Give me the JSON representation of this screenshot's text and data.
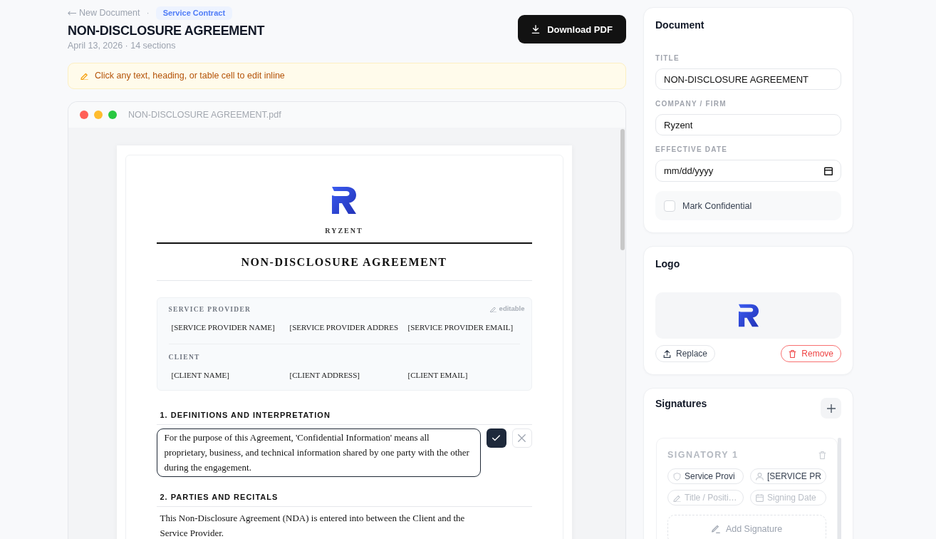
{
  "header": {
    "back_link": "New Document",
    "separator": "·",
    "badge": "Service Contract",
    "title": "NON-DISCLOSURE AGREEMENT",
    "meta": "April 13, 2026 · 14 sections",
    "download_button": "Download PDF"
  },
  "notice": {
    "text": "Click any text, heading, or table cell to edit inline"
  },
  "preview": {
    "filename": "NON-DISCLOSURE AGREEMENT.pdf",
    "document": {
      "company": "RYZENT",
      "title": "NON-DISCLOSURE AGREEMENT",
      "parties_hint": "editable",
      "parties": [
        {
          "label": "SERVICE PROVIDER",
          "values": [
            "[SERVICE PROVIDER NAME]",
            "[SERVICE PROVIDER ADDRES",
            "[SERVICE PROVIDER EMAIL]"
          ]
        },
        {
          "label": "CLIENT",
          "values": [
            "[CLIENT NAME]",
            "[CLIENT ADDRESS]",
            "[CLIENT EMAIL]"
          ]
        }
      ],
      "sections": [
        {
          "heading": "1. DEFINITIONS AND INTERPRETATION",
          "body": "For the purpose of this Agreement, 'Confidential Information' means all proprietary, business, and technical information shared by one party with the other during the engagement.",
          "editing": true
        },
        {
          "heading": "2. PARTIES AND RECITALS",
          "body": "This Non-Disclosure Agreement (NDA) is entered into between the Client and the Service Provider.",
          "editing": false
        }
      ]
    }
  },
  "sidebar": {
    "document": {
      "title": "Document",
      "fields": [
        {
          "kind": "text",
          "label": "TITLE",
          "value": "NON-DISCLOSURE AGREEMENT"
        },
        {
          "kind": "text",
          "label": "COMPANY / FIRM",
          "value": "Ryzent"
        },
        {
          "kind": "date",
          "label": "EFFECTIVE DATE",
          "placeholder": "mm/dd/yyyy"
        }
      ],
      "confidential": {
        "label": "Mark Confidential",
        "checked": false
      }
    },
    "logo": {
      "title": "Logo",
      "replace_button": "Replace",
      "remove_button": "Remove"
    },
    "signatures": {
      "title": "Signatures",
      "signatories": [
        {
          "heading": "SIGNATORY 1",
          "role": "Service Provi",
          "name": "[SERVICE PR",
          "title_placeholder": "Title / Positi…",
          "date_placeholder": "Signing Date",
          "add_signature": "Add Signature"
        }
      ]
    }
  }
}
